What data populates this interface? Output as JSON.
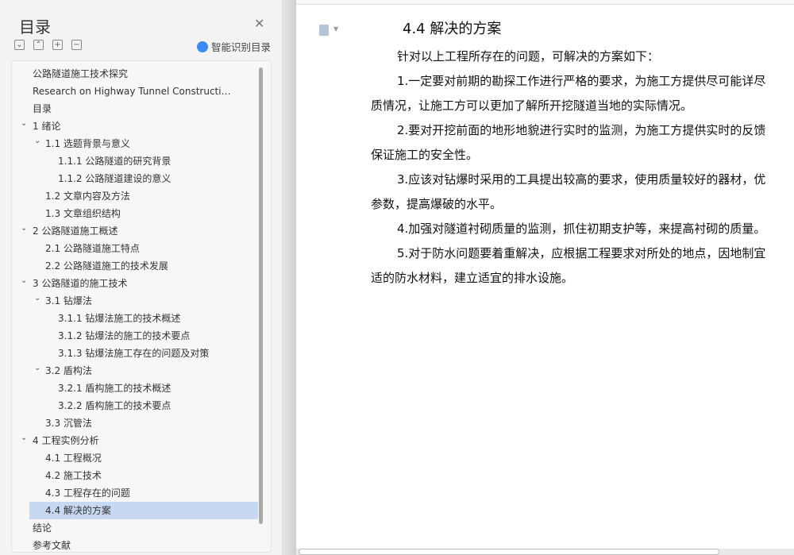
{
  "sidebar": {
    "title": "目录",
    "smart_label": "智能识别目录",
    "toc": [
      {
        "label": "公路隧道施工技术探究",
        "level": 0
      },
      {
        "label": "Research on Highway Tunnel Construction Technology",
        "level": 0
      },
      {
        "label": "目录",
        "level": 0
      },
      {
        "label": "1 绪论",
        "level": 0,
        "expanded": true
      },
      {
        "label": "1.1 选题背景与意义",
        "level": 1,
        "expanded": true
      },
      {
        "label": "1.1.1 公路隧道的研究背景",
        "level": 2
      },
      {
        "label": "1.1.2 公路隧道建设的意义",
        "level": 2
      },
      {
        "label": "1.2 文章内容及方法",
        "level": 1
      },
      {
        "label": "1.3 文章组织结构",
        "level": 1
      },
      {
        "label": "2 公路隧道施工概述",
        "level": 0,
        "expanded": true
      },
      {
        "label": "2.1 公路隧道施工特点",
        "level": 1
      },
      {
        "label": "2.2 公路隧道施工的技术发展",
        "level": 1
      },
      {
        "label": "3 公路隧道的施工技术",
        "level": 0,
        "expanded": true
      },
      {
        "label": "3.1 钻爆法",
        "level": 1,
        "expanded": true
      },
      {
        "label": "3.1.1 钻爆法施工的技术概述",
        "level": 2
      },
      {
        "label": "3.1.2 钻爆法的施工的技术要点",
        "level": 2
      },
      {
        "label": "3.1.3 钻爆法施工存在的问题及对策",
        "level": 2
      },
      {
        "label": "3.2 盾构法",
        "level": 1,
        "expanded": true
      },
      {
        "label": "3.2.1 盾构施工的技术概述",
        "level": 2
      },
      {
        "label": "3.2.2 盾构施工的技术要点",
        "level": 2
      },
      {
        "label": "3.3 沉管法",
        "level": 1
      },
      {
        "label": "4 工程实例分析",
        "level": 0,
        "expanded": true
      },
      {
        "label": "4.1 工程概况",
        "level": 1
      },
      {
        "label": "4.2 施工技术",
        "level": 1
      },
      {
        "label": "4.3 工程存在的问题",
        "level": 1
      },
      {
        "label": "4.4 解决的方案",
        "level": 1,
        "selected": true
      },
      {
        "label": "结论",
        "level": 0
      },
      {
        "label": "参考文献",
        "level": 0
      }
    ]
  },
  "document": {
    "heading": "4.4  解决的方案",
    "lines": [
      {
        "text": "针对以上工程所存在的问题，可解决的方案如下：",
        "indent": true
      },
      {
        "text": "1.一定要对前期的勘探工作进行严格的要求，为施工方提供尽可能详尽",
        "indent": true
      },
      {
        "text": "质情况，让施工方可以更加了解所开挖隧道当地的实际情况。",
        "indent": false
      },
      {
        "text": "2.要对开挖前面的地形地貌进行实时的监测，为施工方提供实时的反馈",
        "indent": true
      },
      {
        "text": "保证施工的安全性。",
        "indent": false
      },
      {
        "text": "3.应该对钻爆时采用的工具提出较高的要求，使用质量较好的器材，优",
        "indent": true
      },
      {
        "text": "参数，提高爆破的水平。",
        "indent": false
      },
      {
        "text": "4.加强对隧道衬砌质量的监测，抓住初期支护等，来提高衬砌的质量。",
        "indent": true
      },
      {
        "text": "5.对于防水问题要着重解决，应根据工程要求对所处的地点，因地制宜",
        "indent": true
      },
      {
        "text": "适的防水材料，建立适宜的排水设施。",
        "indent": false
      }
    ]
  },
  "colors": {
    "selected": "#c7d8f2",
    "accent": "#3b8cf0"
  }
}
